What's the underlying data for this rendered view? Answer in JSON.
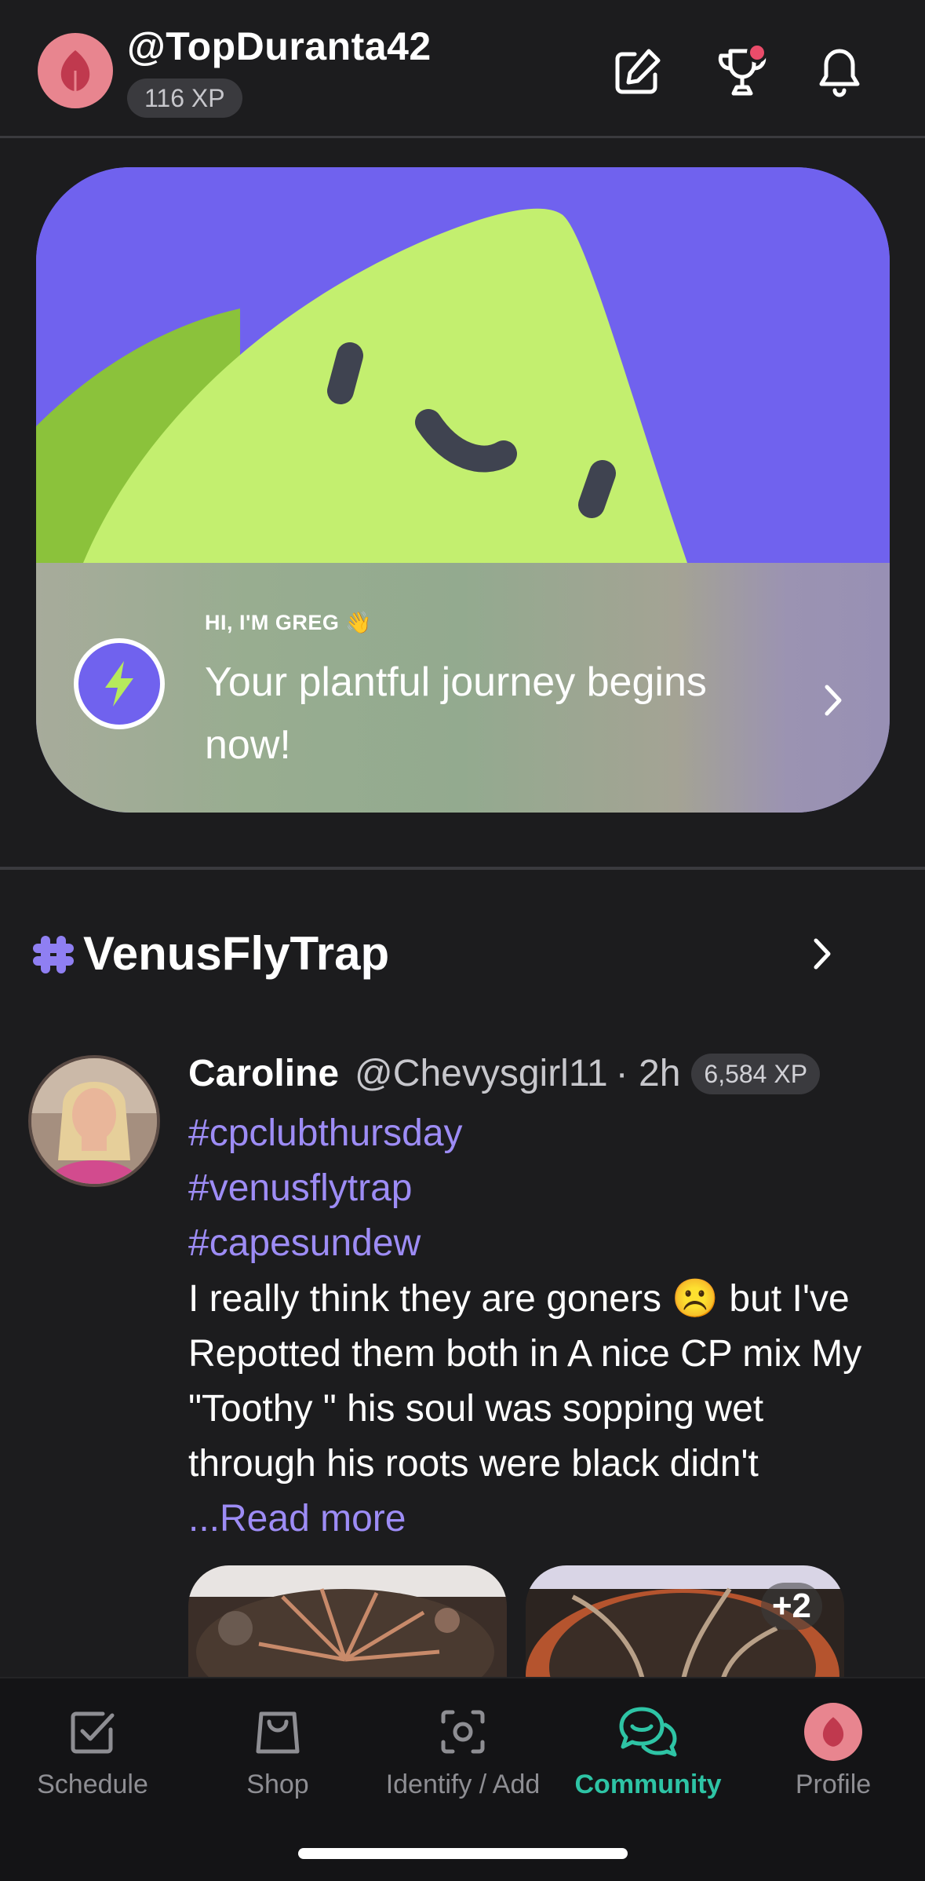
{
  "header": {
    "username": "@TopDuranta42",
    "xp": "116 XP",
    "icons": [
      "compose-icon",
      "trophy-icon",
      "bell-icon"
    ]
  },
  "greg_card": {
    "kicker": "HI, I'M GREG 👋",
    "title": "Your plantful journey begins now!",
    "accent": "#7062ee",
    "mascot_color": "#c3ef6f"
  },
  "section": {
    "title": "VenusFlyTrap",
    "hash_color": "#8f7ff2"
  },
  "post": {
    "name": "Caroline",
    "handle": "@Chevysgirl11",
    "time": "· 2h",
    "xp": "6,584 XP",
    "hashtags": [
      "#cpclubthursday",
      "#venusflytrap",
      "#capesundew"
    ],
    "body": "I really think they are goners ☹️ but I've Repotted them both in A nice CP mix My \"Toothy \" his soul was sopping wet through his roots were black didn't ",
    "read_more": "...Read more",
    "more_photos": "+2"
  },
  "tabs": [
    {
      "label": "Schedule",
      "icon": "schedule-icon",
      "active": false
    },
    {
      "label": "Shop",
      "icon": "shop-icon",
      "active": false
    },
    {
      "label": "Identify / Add",
      "icon": "identify-icon",
      "active": false
    },
    {
      "label": "Community",
      "icon": "community-icon",
      "active": true
    },
    {
      "label": "Profile",
      "icon": "profile-icon",
      "active": false
    }
  ],
  "colors": {
    "background": "#1c1c1e",
    "link": "#9d8cf5",
    "active_tab": "#2ec4a5",
    "notification": "#ea4c6a"
  }
}
